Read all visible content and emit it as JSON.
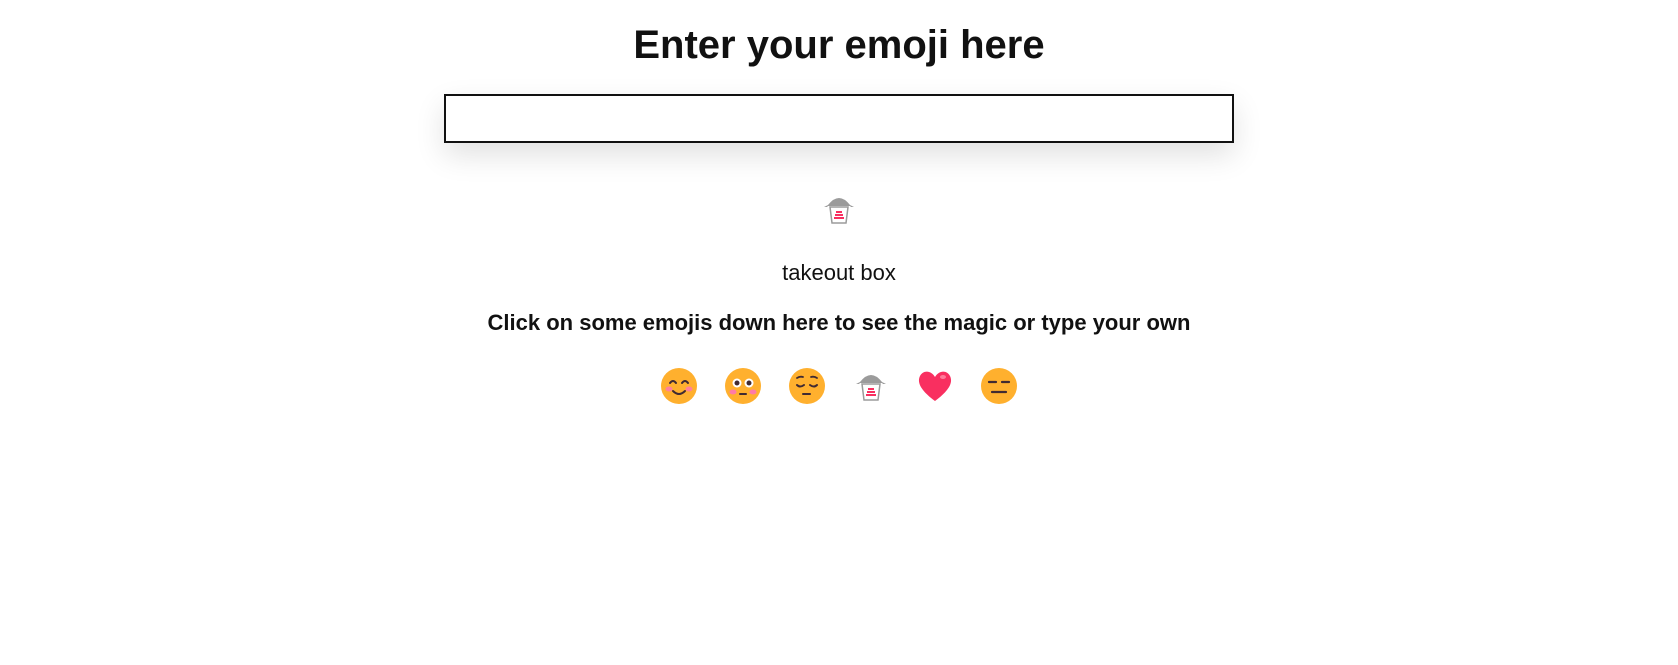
{
  "header": {
    "title": "Enter your emoji here"
  },
  "search": {
    "value": "",
    "placeholder": ""
  },
  "result": {
    "emoji": "takeout-box-icon",
    "name": "takeout box"
  },
  "hint": {
    "text": "Click on some emojis down here to see the magic or type your own"
  },
  "emoji_options": [
    {
      "icon": "smiling-face-with-smiling-eyes-icon"
    },
    {
      "icon": "flushed-face-icon"
    },
    {
      "icon": "pensive-face-icon"
    },
    {
      "icon": "takeout-box-icon"
    },
    {
      "icon": "red-heart-icon"
    },
    {
      "icon": "expressionless-face-icon"
    }
  ],
  "colors": {
    "face_yellow": "#FFB02E",
    "heart_red": "#F92F60",
    "box_gray": "#9B9B9B",
    "blush": "#FF6DC6",
    "text": "#111111"
  }
}
